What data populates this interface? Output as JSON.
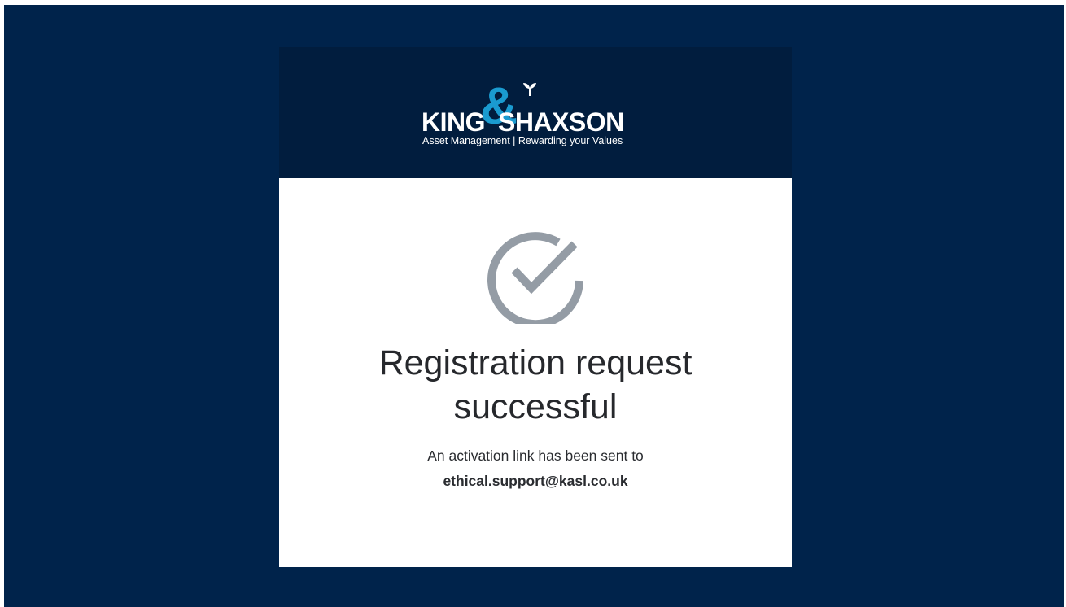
{
  "brand": {
    "name_left": "KING",
    "ampersand": "&",
    "name_right": "SHAXSON",
    "tagline": "Asset Management | Rewarding your Values",
    "colors": {
      "navy_background": "#00234b",
      "header_navy": "#011d3e",
      "accent_blue": "#1a9bd0",
      "check_gray": "#949ca5"
    }
  },
  "status": {
    "icon": "check-circle-icon",
    "title_line1": "Registration request",
    "title_line2": "successful",
    "message": "An activation link has been sent to",
    "email": "ethical.support@kasl.co.uk"
  }
}
